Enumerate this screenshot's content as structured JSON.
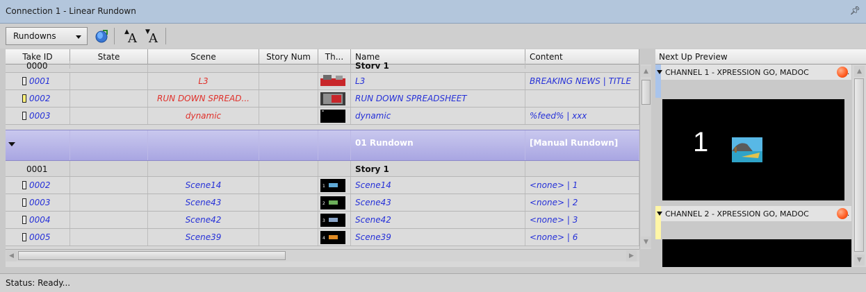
{
  "window": {
    "title": "Connection 1 - Linear Rundown",
    "pin_icon": "pin-icon"
  },
  "toolbar": {
    "rundowns_label": "Rundowns",
    "font_glyph": "A"
  },
  "grid": {
    "columns": [
      "Take ID",
      "State",
      "Scene",
      "Story Num",
      "Th...",
      "Name",
      "Content"
    ],
    "partial_story": {
      "take_id": "0000",
      "name": "Story 1"
    },
    "group1_items": [
      {
        "take_id": "0001",
        "scene": "L3",
        "name": "L3",
        "content": "BREAKING NEWS | TITLE",
        "take_color": "#eeeeee"
      },
      {
        "take_id": "0002",
        "scene": "RUN DOWN SPREAD...",
        "name": "RUN DOWN SPREADSHEET",
        "content": "",
        "take_color": "#fff27a"
      },
      {
        "take_id": "0003",
        "scene": "dynamic",
        "name": "dynamic",
        "content": "%feed% | xxx",
        "take_color": "#eeeeee"
      }
    ],
    "rundown_band": {
      "name": "01 Rundown",
      "content": "[Manual Rundown]"
    },
    "story": {
      "take_id": "0001",
      "name": "Story 1"
    },
    "group2_items": [
      {
        "take_id": "0002",
        "scene": "Scene14",
        "name": "Scene14",
        "content": "<none> | 1",
        "thumb_num": "1"
      },
      {
        "take_id": "0003",
        "scene": "Scene43",
        "name": "Scene43",
        "content": "<none> | 2",
        "thumb_num": "2"
      },
      {
        "take_id": "0004",
        "scene": "Scene42",
        "name": "Scene42",
        "content": "<none> | 3",
        "thumb_num": "3"
      },
      {
        "take_id": "0005",
        "scene": "Scene39",
        "name": "Scene39",
        "content": "<none> | 6",
        "thumb_num": "4"
      }
    ]
  },
  "preview": {
    "header": "Next Up Preview",
    "channel1": {
      "label": "CHANNEL 1 - XPRESSION GO, MADOC",
      "screen_number": "1",
      "strip_color": "#a9c4ec"
    },
    "channel2": {
      "label": "CHANNEL 2 - XPRESSION GO, MADOC",
      "strip_color": "#fff6a6"
    }
  },
  "status": {
    "text": "Status: Ready..."
  },
  "colors": {
    "italic_red": "#e0302a",
    "italic_blue": "#2530d8",
    "band": "#aaa7e3"
  }
}
